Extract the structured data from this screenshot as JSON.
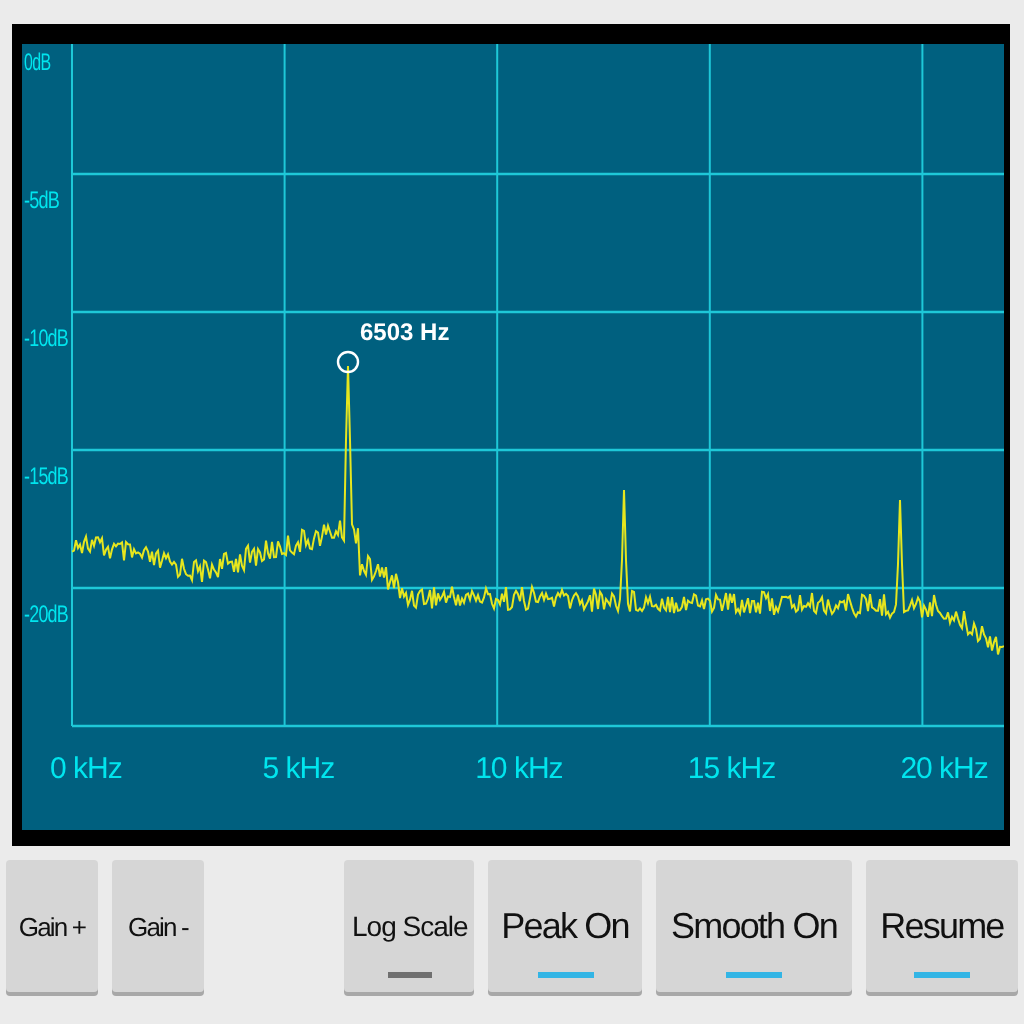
{
  "plot": {
    "y_labels": [
      "0dB",
      "-5dB",
      "-10dB",
      "-15dB",
      "-20dB"
    ],
    "x_labels": [
      "0 kHz",
      "5 kHz",
      "10 kHz",
      "15 kHz",
      "20 kHz"
    ],
    "peak": {
      "label": "6503 Hz"
    }
  },
  "left_buttons": [
    {
      "label": "Gain +",
      "kind": "action"
    },
    {
      "label": "Gain -",
      "kind": "action"
    }
  ],
  "right_buttons": [
    {
      "label": "Log Scale",
      "kind": "toggle",
      "on": false
    },
    {
      "label": "Peak On",
      "kind": "toggle",
      "on": true
    },
    {
      "label": "Smooth On",
      "kind": "toggle",
      "on": true
    },
    {
      "label": "Resume",
      "kind": "toggle",
      "on": true
    }
  ]
}
